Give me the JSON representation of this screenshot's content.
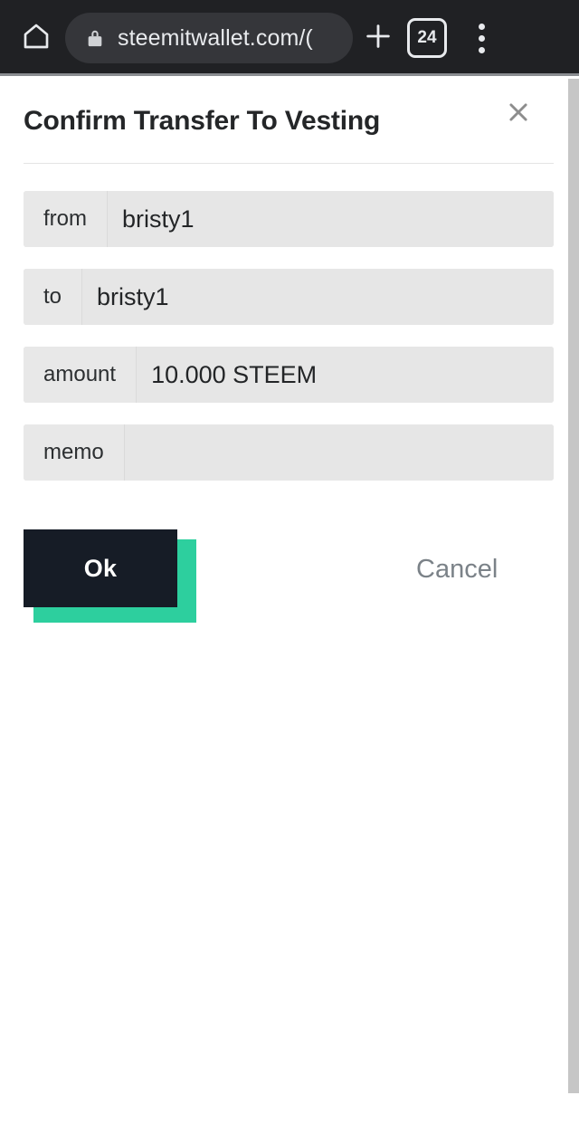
{
  "browser": {
    "home_icon": "home-icon",
    "lock_icon": "lock-icon",
    "url": "steemitwallet.com/(",
    "new_tab_icon": "plus-icon",
    "tab_count": "24",
    "menu_icon": "three-dot-menu-icon",
    "bar_background": "#202124",
    "url_pill_background": "#35363a"
  },
  "dialog": {
    "title": "Confirm Transfer To Vesting",
    "close_icon": "close-x-icon",
    "rows": [
      {
        "label": "from",
        "value": "bristy1"
      },
      {
        "label": "to",
        "value": "bristy1"
      },
      {
        "label": "amount",
        "value": "10.000 STEEM"
      },
      {
        "label": "memo",
        "value": ""
      }
    ],
    "actions": {
      "ok_label": "Ok",
      "cancel_label": "Cancel"
    },
    "colors": {
      "ok_background": "#161c26",
      "ok_shadow": "#2dcf9e",
      "cancel_text": "#7b8288",
      "field_background": "#e8e8e8",
      "title_text": "#242628"
    }
  }
}
